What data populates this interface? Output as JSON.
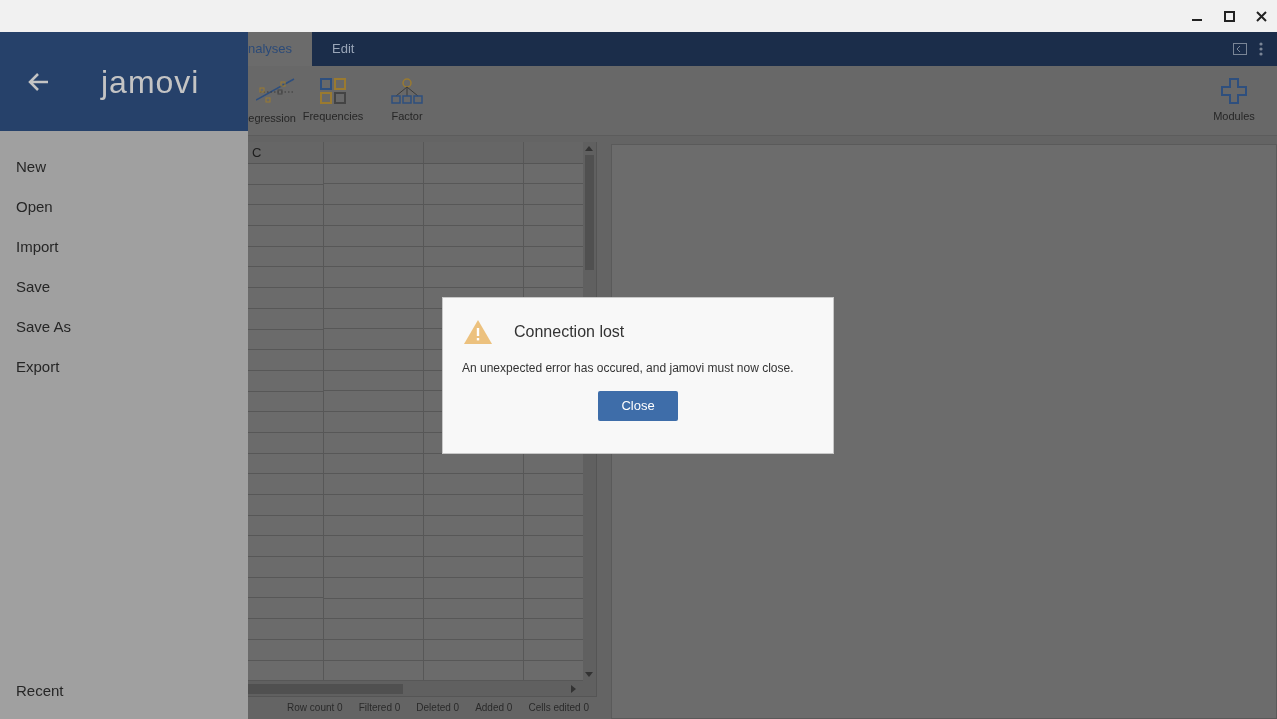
{
  "drawer": {
    "logo": "jamovi",
    "items": [
      {
        "label": "New"
      },
      {
        "label": "Open"
      },
      {
        "label": "Import"
      },
      {
        "label": "Save"
      },
      {
        "label": "Save As"
      },
      {
        "label": "Export"
      }
    ],
    "footer_item": "Recent"
  },
  "tabs": [
    {
      "label": "nalyses",
      "selected": true
    },
    {
      "label": "Edit",
      "selected": false
    }
  ],
  "ribbon": [
    {
      "label": "egression",
      "kind": "regression"
    },
    {
      "label": "Frequencies",
      "kind": "frequencies"
    },
    {
      "label": "Factor",
      "kind": "factor"
    }
  ],
  "modules": {
    "label": "Modules"
  },
  "spreadsheet": {
    "columns": [
      "C",
      "",
      "",
      ""
    ],
    "status": [
      "Row count 0",
      "Filtered 0",
      "Deleted 0",
      "Added 0",
      "Cells edited 0"
    ]
  },
  "dialog": {
    "title": "Connection lost",
    "message": "An unexpected error has occured, and jamovi must now close.",
    "button": "Close"
  }
}
